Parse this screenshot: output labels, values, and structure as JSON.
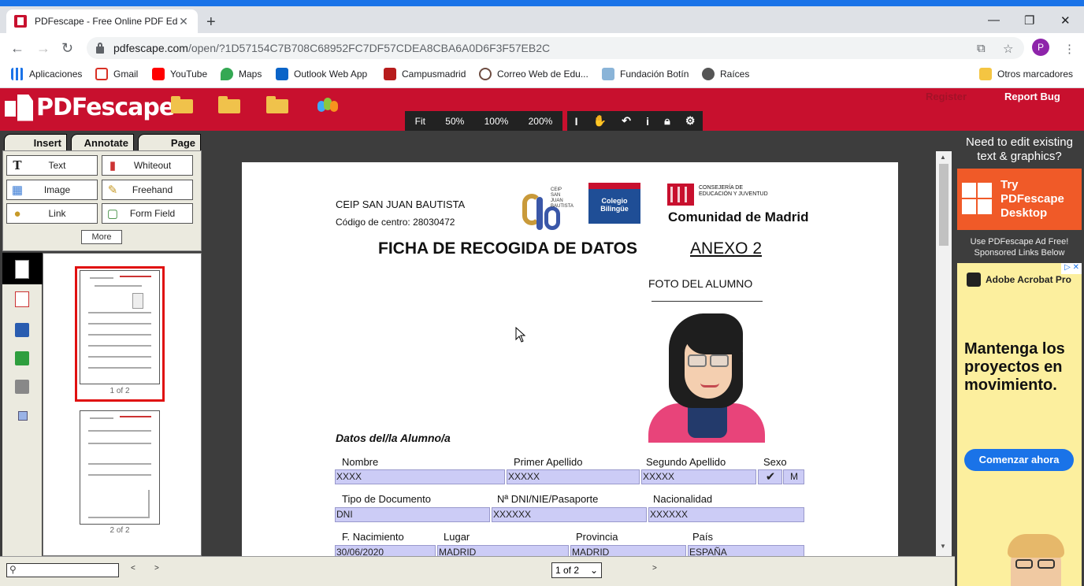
{
  "browser": {
    "tab_title": "PDFescape - Free Online PDF Edi",
    "tab_close": "✕",
    "new_tab": "+",
    "url_host": "pdfescape.com",
    "url_path": "/open/?1D57154C7B708C68952FC7DF57CDEA8CBA6A0D6F3F57EB2C",
    "profile_initial": "P",
    "accent_color": "#1a73e8"
  },
  "bookmarks": [
    {
      "label": "Aplicaciones",
      "icon": "apps-grid-icon"
    },
    {
      "label": "Gmail",
      "icon": "gmail-icon"
    },
    {
      "label": "YouTube",
      "icon": "youtube-icon"
    },
    {
      "label": "Maps",
      "icon": "maps-icon"
    },
    {
      "label": "Outlook Web App",
      "icon": "outlook-icon"
    },
    {
      "label": "Campusmadrid",
      "icon": "campusmadrid-icon"
    },
    {
      "label": "Correo Web de Edu...",
      "icon": "mail-web-icon"
    },
    {
      "label": "Fundación Botín",
      "icon": "fundacion-icon"
    },
    {
      "label": "Raíces",
      "icon": "globe-icon"
    },
    {
      "label": "Otros marcadores",
      "icon": "folder-icon"
    }
  ],
  "app": {
    "logo": "PDFescape",
    "brand_color": "#c8102e",
    "register": "Register",
    "report_bug": "Report Bug",
    "zoom": [
      "Fit",
      "50%",
      "100%",
      "200%"
    ],
    "tabs": [
      "Insert",
      "Annotate",
      "Page"
    ],
    "insert_buttons": [
      {
        "label": "Text",
        "icon": "text-tool-icon"
      },
      {
        "label": "Whiteout",
        "icon": "whiteout-icon"
      },
      {
        "label": "Image",
        "icon": "image-icon"
      },
      {
        "label": "Freehand",
        "icon": "pencil-icon"
      },
      {
        "label": "Link",
        "icon": "link-icon"
      },
      {
        "label": "Form Field",
        "icon": "form-field-icon"
      }
    ],
    "more": "More",
    "thumbs": [
      "1 of 2",
      "2 of 2"
    ],
    "page_select": "1 of 2"
  },
  "document": {
    "school": "CEIP SAN JUAN BAUTISTA",
    "code": "Código de centro: 28030472",
    "title": "FICHA DE RECOGIDA DE DATOS",
    "annex": "ANEXO 2",
    "photo_label": "FOTO DEL ALUMNO",
    "bilingue": "Colegio Bilingüe",
    "consejeria": "CONSEJERÍA DE EDUCACIÓN Y JUVENTUD",
    "comunidad": "Comunidad de Madrid",
    "section": "Datos del/la Alumno/a",
    "labels": {
      "nombre": "Nombre",
      "apellido1": "Primer Apellido",
      "apellido2": "Segundo Apellido",
      "sexo": "Sexo",
      "tipo_doc": "Tipo de Documento",
      "dni": "Nª DNI/NIE/Pasaporte",
      "nacionalidad": "Nacionalidad",
      "nacimiento": "F. Nacimiento",
      "lugar": "Lugar",
      "provincia": "Provincia",
      "pais": "País"
    },
    "values": {
      "nombre": "XXXX",
      "apellido1": "XXXXX",
      "apellido2": "XXXXX",
      "sexo_h": "✔",
      "sexo_m": "M",
      "tipo_doc": "DNI",
      "dni": "XXXXXX",
      "nacionalidad": "XXXXXX",
      "nacimiento": "30/06/2020",
      "lugar": "MADRID",
      "provincia": "MADRID",
      "pais": "ESPAÑA"
    }
  },
  "ad": {
    "headline": "Need to edit existing text & graphics?",
    "offer": "Try PDFescape Desktop",
    "sponsored": "Use PDFescape Ad Free! Sponsored Links Below",
    "brand": "Adobe Acrobat Pro",
    "ad_choice": "▷ ✕",
    "body": "Mantenga los proyectos en movimiento.",
    "cta": "Comenzar ahora"
  }
}
